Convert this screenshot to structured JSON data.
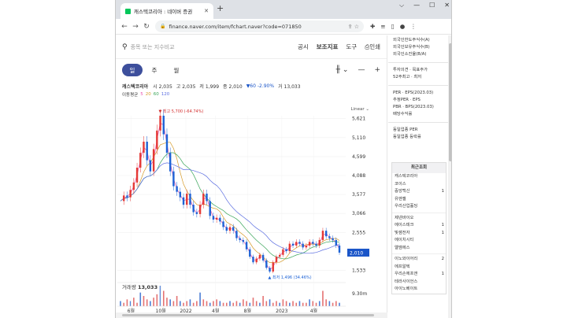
{
  "browser": {
    "tab_title": "캐스텍코리아 : 네이버 증권",
    "url": "finance.naver.com/item/fchart.naver?code=071850",
    "window_controls": [
      "⌵",
      "—",
      "☐",
      "✕"
    ]
  },
  "search": {
    "placeholder": "종목 또는 지수비교",
    "menu": [
      "공시",
      "보조지표",
      "도구",
      "인쇄"
    ]
  },
  "periods": [
    "일",
    "주",
    "월"
  ],
  "selected_period": "일",
  "stock": {
    "name": "캐스텍코리아",
    "open_label": "시",
    "open": "2,035",
    "high_label": "고",
    "high": "2,035",
    "low_label": "저",
    "low": "1,999",
    "close_label": "종",
    "close": "2,010",
    "change": "▼60 -2.90%",
    "volume_label": "거",
    "volume": "13,033"
  },
  "moving_average": {
    "label": "이동평균",
    "periods": [
      "5",
      "20",
      "60",
      "120"
    ],
    "colors": [
      "#e84fae",
      "#d69b2a",
      "#3aa55a",
      "#5b6ee1"
    ]
  },
  "chart_data": {
    "type": "line",
    "scale_label": "Linear",
    "y_ticks": [
      "5,621",
      "5,110",
      "4,599",
      "4,088",
      "3,577",
      "3,066",
      "2,555",
      "2,010",
      "1,533"
    ],
    "x_ticks": [
      "6월",
      "10월",
      "2022",
      "4월",
      "8월",
      "2023",
      "4월"
    ],
    "max_annotation": "최고 5,700 (-64.74%)",
    "min_annotation": "최저 1,496 (34.46%)",
    "current_price": "2,010",
    "x_range": [
      "2021-05",
      "2023-06"
    ],
    "y_range": [
      1500,
      5700
    ],
    "price_series": [
      [
        0,
        3400
      ],
      [
        1,
        3550
      ],
      [
        2,
        3500
      ],
      [
        3,
        3700
      ],
      [
        4,
        3900
      ],
      [
        5,
        4300
      ],
      [
        6,
        4700
      ],
      [
        7,
        5000
      ],
      [
        8,
        4500
      ],
      [
        9,
        4200
      ],
      [
        10,
        4800
      ],
      [
        11,
        5300
      ],
      [
        12,
        5700
      ],
      [
        13,
        5200
      ],
      [
        14,
        4700
      ],
      [
        15,
        4200
      ],
      [
        16,
        3800
      ],
      [
        17,
        3650
      ],
      [
        18,
        3500
      ],
      [
        19,
        3300
      ],
      [
        20,
        3600
      ],
      [
        21,
        3300
      ],
      [
        22,
        3100
      ],
      [
        23,
        3050
      ],
      [
        24,
        3300
      ],
      [
        25,
        3600
      ],
      [
        26,
        3400
      ],
      [
        27,
        3000
      ],
      [
        28,
        2900
      ],
      [
        29,
        2950
      ],
      [
        30,
        2850
      ],
      [
        31,
        2700
      ],
      [
        32,
        2600
      ],
      [
        33,
        2700
      ],
      [
        34,
        2600
      ],
      [
        35,
        2400
      ],
      [
        36,
        2350
      ],
      [
        37,
        2300
      ],
      [
        38,
        2100
      ],
      [
        39,
        1900
      ],
      [
        40,
        1750
      ],
      [
        41,
        1850
      ],
      [
        42,
        1950
      ],
      [
        43,
        1800
      ],
      [
        44,
        1600
      ],
      [
        45,
        1500
      ],
      [
        46,
        1750
      ],
      [
        47,
        1900
      ],
      [
        48,
        1950
      ],
      [
        49,
        2100
      ],
      [
        50,
        2050
      ],
      [
        51,
        2250
      ],
      [
        52,
        2200
      ],
      [
        53,
        2300
      ],
      [
        54,
        2250
      ],
      [
        55,
        2150
      ],
      [
        56,
        2200
      ],
      [
        57,
        2300
      ],
      [
        58,
        2250
      ],
      [
        59,
        2200
      ],
      [
        60,
        2350
      ],
      [
        61,
        2600
      ],
      [
        62,
        2450
      ],
      [
        63,
        2400
      ],
      [
        64,
        2350
      ],
      [
        65,
        2200
      ],
      [
        66,
        2010
      ]
    ],
    "volume_series": [
      3,
      2,
      4,
      3,
      5,
      2,
      8,
      6,
      4,
      3,
      5,
      7,
      12,
      9,
      5,
      4,
      3,
      6,
      3,
      2,
      3,
      4,
      2,
      3,
      8,
      4,
      3,
      2,
      3,
      4,
      3,
      2,
      2,
      3,
      2,
      3,
      2,
      4,
      3,
      2,
      5,
      3,
      2,
      6,
      3,
      4,
      2,
      3,
      2,
      4,
      3,
      2,
      3,
      2,
      3,
      2,
      2,
      4,
      3,
      2,
      3,
      9,
      4,
      3,
      2,
      3,
      2
    ],
    "volume_label": "거래량",
    "volume_value": "13,033",
    "volume_tick": "9.30m"
  },
  "right_panel": {
    "investor_lines": [
      "외국인한도주식수(A)",
      "외국인보유주식수(B)",
      "외국인소진율(B/A)"
    ],
    "opinion_lines": [
      "투자의견 · 목표주가",
      "52주최고 · 최저"
    ],
    "valuation_lines": [
      "PER · EPS(2023.03)",
      "추정PER · EPS",
      "PBR · BPS(2023.03)",
      "배당수익률"
    ],
    "industry_lines": [
      "동일업종 PER",
      "동일업종 등락률"
    ],
    "recent_title": "최근조회",
    "recent_groups": [
      [
        [
          "캐스텍코리아",
          ""
        ],
        [
          "코이스",
          ""
        ],
        [
          "중앙백신",
          "1"
        ],
        [
          "유엔젤",
          ""
        ],
        [
          "우리산업홀딩",
          ""
        ]
      ],
      [
        [
          "제넨바이오",
          ""
        ],
        [
          "에이스테크",
          "1"
        ],
        [
          "빛샘전자",
          "1"
        ],
        [
          "에이치시티",
          ""
        ],
        [
          "엘엠에스",
          ""
        ]
      ],
      [
        [
          "이노와이어리",
          "2"
        ],
        [
          "에프알텍",
          ""
        ],
        [
          "우리손에프앤",
          "1"
        ],
        [
          "테라사이언스",
          ""
        ],
        [
          "아이노베이트",
          ""
        ]
      ]
    ]
  }
}
